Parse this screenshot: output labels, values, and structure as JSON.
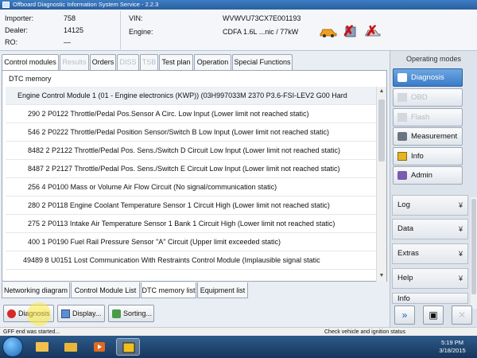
{
  "window": {
    "title": "Offboard Diagnostic Information System Service - 2.2.3"
  },
  "info": {
    "importer_label": "Importer:",
    "importer_value": "758",
    "dealer_label": "Dealer:",
    "dealer_value": "14125",
    "ro_label": "RO:",
    "ro_value": "—",
    "vin_label": "VIN:",
    "vin_value": "WVWVU73CX7E001193",
    "engine_label": "Engine:",
    "engine_value": "CDFA 1.6L ...nic / 77kW"
  },
  "tabs": [
    {
      "label": "Control modules",
      "state": "active"
    },
    {
      "label": "Results",
      "state": "disabled"
    },
    {
      "label": "Orders",
      "state": "normal"
    },
    {
      "label": "DISS",
      "state": "disabled"
    },
    {
      "label": "TSB",
      "state": "disabled"
    },
    {
      "label": "Test plan",
      "state": "normal"
    },
    {
      "label": "Operation",
      "state": "normal"
    },
    {
      "label": "Special Functions",
      "state": "normal"
    }
  ],
  "panel": {
    "title": "DTC memory"
  },
  "dtc": {
    "header": "Engine Control Module 1 (01 - Engine electronics (KWP)) (03H997033M     2370   P3.6-FSI-LEV2   G00   Hard",
    "rows": [
      "290  2  P0122  Throttle/Pedal Pos.Sensor A Circ. Low Input  (Lower limit not reached   static)",
      "546  2  P0222  Throttle/Pedal Position Sensor/Switch B Low Input  (Lower limit not reached   static)",
      "8482  2  P2122  Throttle/Pedal Pos. Sens./Switch D Circuit Low Input  (Lower limit not reached   static)",
      "8487  2  P2127  Throttle/Pedal Pos. Sens./Switch E Circuit Low Input  (Lower limit not reached   static)",
      "256  4  P0100  Mass or Volume Air Flow Circuit  (No signal/communication   static)",
      "280  2  P0118  Engine Coolant Temperature Sensor 1 Circuit High  (Lower limit not reached   static)",
      "275  2  P0113  Intake Air Temperature Sensor 1 Bank 1 Circuit High  (Lower limit not reached   static)",
      "400  1  P0190  Fuel Rail Pressure Sensor \"A\" Circuit  (Upper limit exceeded   static)",
      "49489  8  U0151  Lost Communication With Restraints Control Module  (Implausible signal   static"
    ]
  },
  "bottom_tabs": [
    {
      "label": "Networking diagram",
      "active": false
    },
    {
      "label": "Control Module List",
      "active": false
    },
    {
      "label": "DTC memory list",
      "active": true
    },
    {
      "label": "Equipment list",
      "active": false
    }
  ],
  "actions": {
    "diagnosis": "Diagnosis",
    "display": "Display...",
    "sorting": "Sorting..."
  },
  "side": {
    "heading": "Operating modes",
    "buttons": [
      {
        "label": "Diagnosis",
        "state": "selected"
      },
      {
        "label": "OBD",
        "state": "disabled"
      },
      {
        "label": "Flash",
        "state": "disabled"
      },
      {
        "label": "Measurement",
        "state": "normal"
      },
      {
        "label": "Info",
        "state": "normal"
      },
      {
        "label": "Admin",
        "state": "normal"
      }
    ],
    "accordion": [
      "Log",
      "Data",
      "Extras",
      "Help",
      "Info"
    ]
  },
  "status": {
    "left": "GFF end was started...",
    "right": "Check vehicle and ignition status"
  },
  "taskbar": {
    "time": "5:19 PM",
    "date": "3/18/2015"
  },
  "colors": {
    "accent": "#3b7bc8",
    "error_x": "#cc1010",
    "title_bar": "#2a5f9e"
  }
}
